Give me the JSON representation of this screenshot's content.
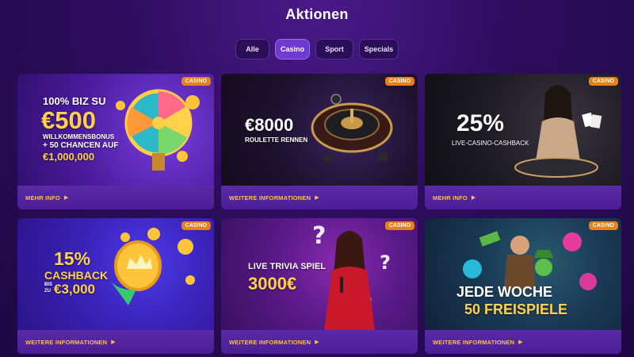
{
  "page": {
    "title": "Aktionen"
  },
  "tabs": [
    {
      "label": "Alle",
      "active": false
    },
    {
      "label": "Casino",
      "active": true
    },
    {
      "label": "Sport",
      "active": false
    },
    {
      "label": "Specials",
      "active": false
    }
  ],
  "badge_label": "CASINO",
  "cards": [
    {
      "footer": "MEHR INFO",
      "lines": [
        "100% BIZ SU",
        "€500",
        "WILLKOMMENSBONUS",
        "+ 50 CHANCEN AUF",
        "€1,000,000"
      ]
    },
    {
      "footer": "WEITERE INFORMATIONEN",
      "lines": [
        "€8000",
        "ROULETTE RENNEN"
      ]
    },
    {
      "footer": "MEHR INFO",
      "lines": [
        "25%",
        "LIVE-CASINO-CASHBACK"
      ]
    },
    {
      "footer": "WEITERE INFORMATIONEN",
      "lines": [
        "15%",
        "CASHBACK",
        "BIS",
        "ZU",
        "€3,000"
      ]
    },
    {
      "footer": "WEITERE INFORMATIONEN",
      "lines": [
        "LIVE TRIVIA SPIEL",
        "3000€"
      ]
    },
    {
      "footer": "WEITERE INFORMATIONEN",
      "lines": [
        "JEDE WOCHE",
        "50 FREISPIELE"
      ]
    }
  ],
  "colors": {
    "accent": "#6f3ad0",
    "footer_link": "#ffc04a",
    "badge": "#e8811a",
    "gold_text": "#ffd24a"
  }
}
